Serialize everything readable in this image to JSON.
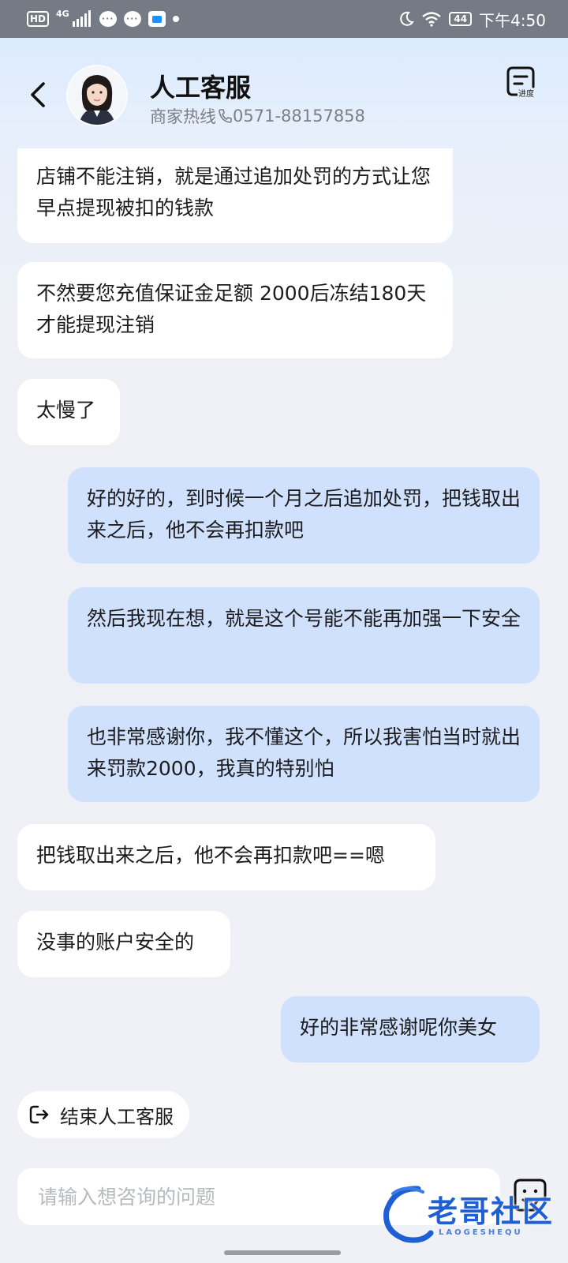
{
  "status_bar": {
    "hd": "HD",
    "network": "4G",
    "battery": "44",
    "time": "下午4:50"
  },
  "header": {
    "title": "人工客服",
    "hotline_label": "商家热线",
    "hotline_number": "0571-88157858",
    "progress_label": "进度"
  },
  "messages": [
    {
      "side": "agent",
      "text": "店铺不能注销，就是通过追加处罚的方式让您早点提现被扣的钱款"
    },
    {
      "side": "agent",
      "text": "不然要您充值保证金足额 2000后冻结180天才能提现注销"
    },
    {
      "side": "agent",
      "text": "太慢了"
    },
    {
      "side": "user",
      "text": "好的好的，到时候一个月之后追加处罚，把钱取出来之后，他不会再扣款吧"
    },
    {
      "side": "user",
      "text": "然后我现在想，就是这个号能不能再加强一下安全"
    },
    {
      "side": "user",
      "text": "也非常感谢你，我不懂这个，所以我害怕当时就出来罚款2000，我真的特别怕"
    },
    {
      "side": "agent",
      "text": "把钱取出来之后，他不会再扣款吧==嗯"
    },
    {
      "side": "agent",
      "text": "没事的账户安全的"
    },
    {
      "side": "user",
      "text": "好的非常感谢呢你美女"
    }
  ],
  "end_service": {
    "label": "结束人工客服"
  },
  "input": {
    "placeholder": "请输入想咨询的问题"
  },
  "watermark": {
    "text": "老哥社区",
    "sub": "LAOGESHEQU"
  },
  "colors": {
    "user_bubble": "#cfe1fc",
    "agent_bubble": "#ffffff",
    "status_bar": "#757b84"
  }
}
